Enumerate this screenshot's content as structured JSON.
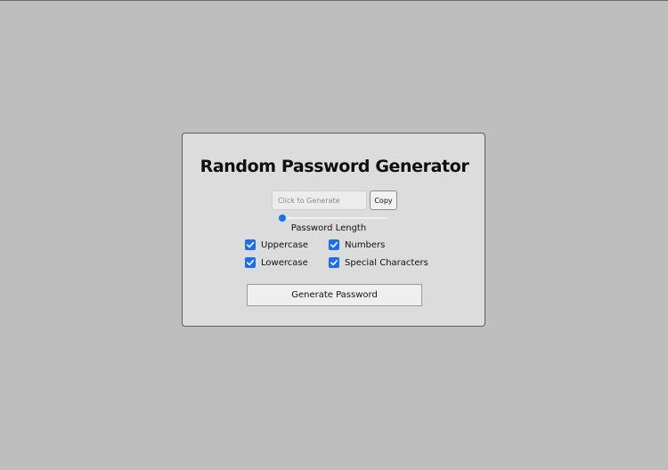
{
  "page": {
    "background_color": "#bebebe",
    "card_color": "#dcdcdc",
    "accent_color": "#1a6ef5"
  },
  "generator": {
    "title": "Random Password Generator",
    "password_value": "",
    "password_placeholder": "Click to Generate",
    "copy_label": "Copy",
    "length_label": "Password Length",
    "length_fraction": 0.0,
    "options": [
      {
        "label": "Uppercase",
        "checked": true
      },
      {
        "label": "Numbers",
        "checked": true
      },
      {
        "label": "Lowercase",
        "checked": true
      },
      {
        "label": "Special Characters",
        "checked": true
      }
    ],
    "generate_label": "Generate Password",
    "icons": {
      "checkbox_check": "checkmark-icon"
    }
  }
}
